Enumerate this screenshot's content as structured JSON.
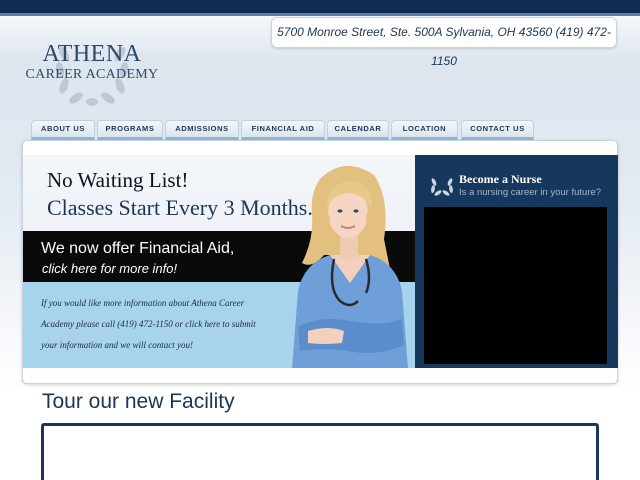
{
  "logo": {
    "title": "ATHENA",
    "subtitle": "CAREER ACADEMY"
  },
  "header": {
    "address": "5700 Monroe Street, Ste. 500A Sylvania, OH 43560 (419) 472-1150"
  },
  "nav": {
    "tabs": [
      {
        "label": "ABOUT US"
      },
      {
        "label": "PROGRAMS"
      },
      {
        "label": "ADMISSIONS"
      },
      {
        "label": "FINANCIAL AID"
      },
      {
        "label": "CALENDAR"
      },
      {
        "label": "LOCATION"
      },
      {
        "label": "CONTACT US"
      }
    ]
  },
  "hero": {
    "headline": "No Waiting List!",
    "subheadline": "Classes Start Every 3 Months.",
    "financial_aid_title": "We now offer Financial Aid,",
    "financial_aid_link": "click here for more info!",
    "info_text": "If you would like more information about Athena Career Academy please call (419) 472-1150 or click here to submit your information and we will contact you!"
  },
  "video_panel": {
    "title": "Become a Nurse",
    "subtitle": "Is a nursing career in your future?"
  },
  "tour": {
    "title": "Tour our new Facility"
  },
  "colors": {
    "navy": "#1b3656",
    "topbar": "#0f2d4e",
    "light_blue": "#a8d3ec",
    "video_panel": "#16385c"
  }
}
